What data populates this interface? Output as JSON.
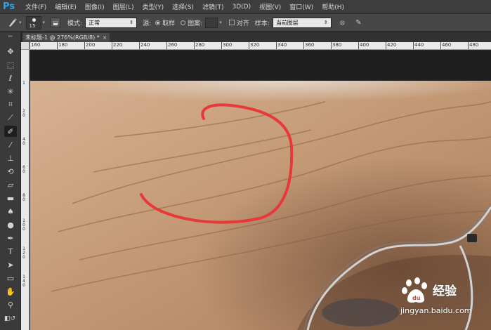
{
  "app": {
    "logo": "Ps",
    "menu": [
      "文件(F)",
      "编辑(E)",
      "图像(I)",
      "图层(L)",
      "类型(Y)",
      "选择(S)",
      "滤镜(T)",
      "3D(D)",
      "视图(V)",
      "窗口(W)",
      "帮助(H)"
    ]
  },
  "options": {
    "brush_size": "15",
    "mode_label": "模式:",
    "mode_value": "正常",
    "source_label": "源:",
    "sampled_label": "取样",
    "pattern_label": "图案:",
    "aligned_label": "对齐",
    "sample_label": "样本:",
    "sample_value": "当前图层"
  },
  "document": {
    "tab_title": "未标题-1 @ 276%(RGB/8) *",
    "close": "×"
  },
  "ruler": {
    "h_ticks": [
      "160",
      "180",
      "200",
      "220",
      "240",
      "260",
      "280",
      "300",
      "320",
      "340",
      "360",
      "380",
      "400",
      "420",
      "440",
      "460",
      "480"
    ],
    "v_ticks": [
      "1",
      "2 0",
      "4 0",
      "6 0",
      "8 0",
      "1 0 0",
      "1 2 0",
      "1 4 0"
    ]
  },
  "tools": [
    "move-tool-icon",
    "marquee-tool-icon",
    "lasso-tool-icon",
    "magic-wand-icon",
    "crop-tool-icon",
    "eyedropper-icon",
    "healing-brush-icon",
    "brush-tool-icon",
    "stamp-tool-icon",
    "history-brush-icon",
    "eraser-icon",
    "gradient-icon",
    "blur-icon",
    "dodge-icon",
    "pen-icon",
    "type-icon",
    "path-select-icon",
    "shape-icon",
    "hand-icon",
    "zoom-icon"
  ],
  "watermark": {
    "brand": "经验",
    "url": "jingyan.baidu.com"
  },
  "colors": {
    "accent": "#2fa3e6",
    "stroke": "#e8383a",
    "skin": "#c99f7c"
  }
}
